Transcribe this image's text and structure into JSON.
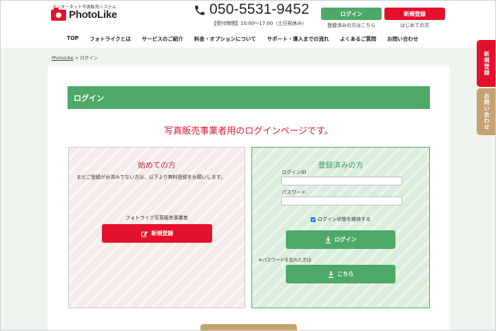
{
  "header": {
    "logo_sub": "インターネット写真販売システム",
    "logo_text": "PhotoLike",
    "phone_number": "050-5531-9452",
    "phone_hours": "【受付時間】10:00〜17:00（土日祝休み）",
    "login_button": "ログイン",
    "login_sub": "登録済みの方はこちら",
    "signup_button": "新規登録",
    "signup_sub": "はじめての方"
  },
  "nav": {
    "items": [
      "TOP",
      "フォトライクとは",
      "サービスのご紹介",
      "料金・オプションについて",
      "サポート・導入までの流れ",
      "よくあるご質問",
      "お問い合わせ"
    ]
  },
  "breadcrumb": {
    "home": "PhotoLike",
    "separator": " > ",
    "current": "ログイン"
  },
  "main": {
    "title": "ログイン",
    "heading": "写真販売事業者用のログインページです。"
  },
  "new_panel": {
    "title": "始めての方",
    "description": "まだご登録がお済みでない方は、以下より無料登録をお願いします。",
    "caption": "フォトライク写真販売事業者",
    "button": "新規登録"
  },
  "reg_panel": {
    "title": "登録済みの方",
    "login_id_label": "ログインID",
    "login_id_value": "",
    "password_label": "パスワード",
    "password_value": "",
    "remember_label": "ログイン状態を維持する",
    "remember_checked": true,
    "login_button": "ログイン",
    "forgot_text": "※パスワードを忘れた方は",
    "forgot_button": "こちら"
  },
  "side_tabs": {
    "signup": "新規登録",
    "contact": "お問い合わせ"
  },
  "colors": {
    "brand_green": "#4ea968",
    "brand_red": "#e4112c",
    "heading_red": "#d7172e",
    "gold": "#c4a272"
  }
}
